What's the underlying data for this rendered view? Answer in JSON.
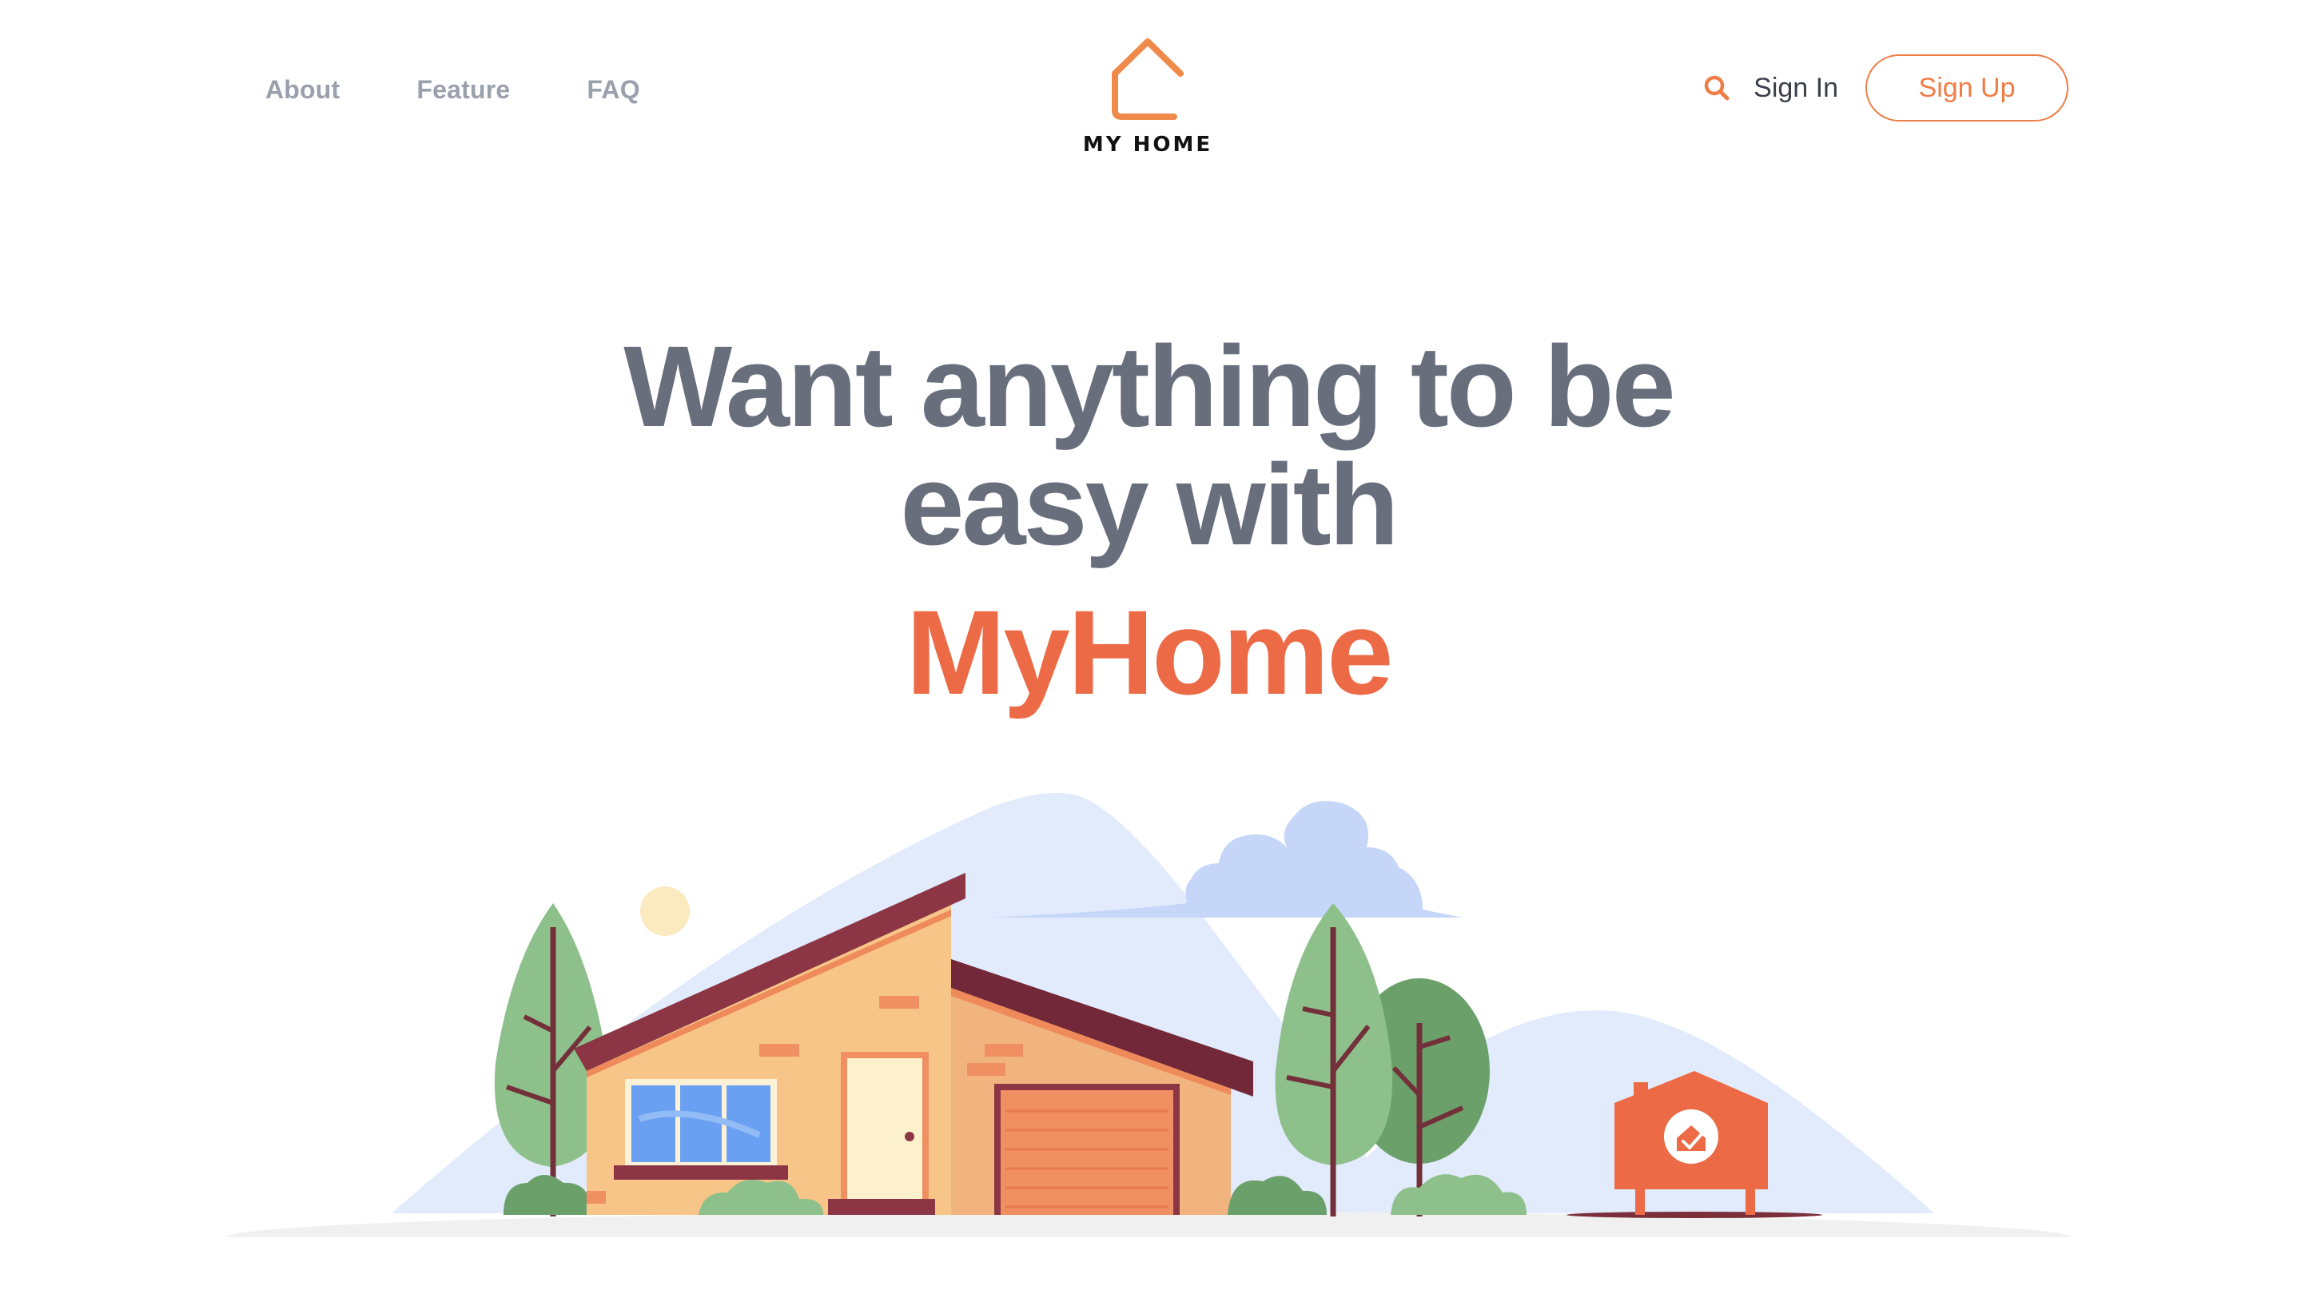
{
  "nav": {
    "left_links": [
      "About",
      "Feature",
      "FAQ"
    ],
    "search_icon": "search-icon",
    "sign_in": "Sign In",
    "sign_up": "Sign Up"
  },
  "logo": {
    "text": "MY HOME",
    "icon": "house-outline-icon"
  },
  "hero": {
    "title_line1": "Want anything to be",
    "title_line2": "easy with",
    "brand": "MyHome"
  },
  "colors": {
    "accent": "#ef7d46",
    "brand_red": "#ec6a45",
    "title_gray": "#686e7c",
    "nav_gray": "#9aa0ac"
  }
}
